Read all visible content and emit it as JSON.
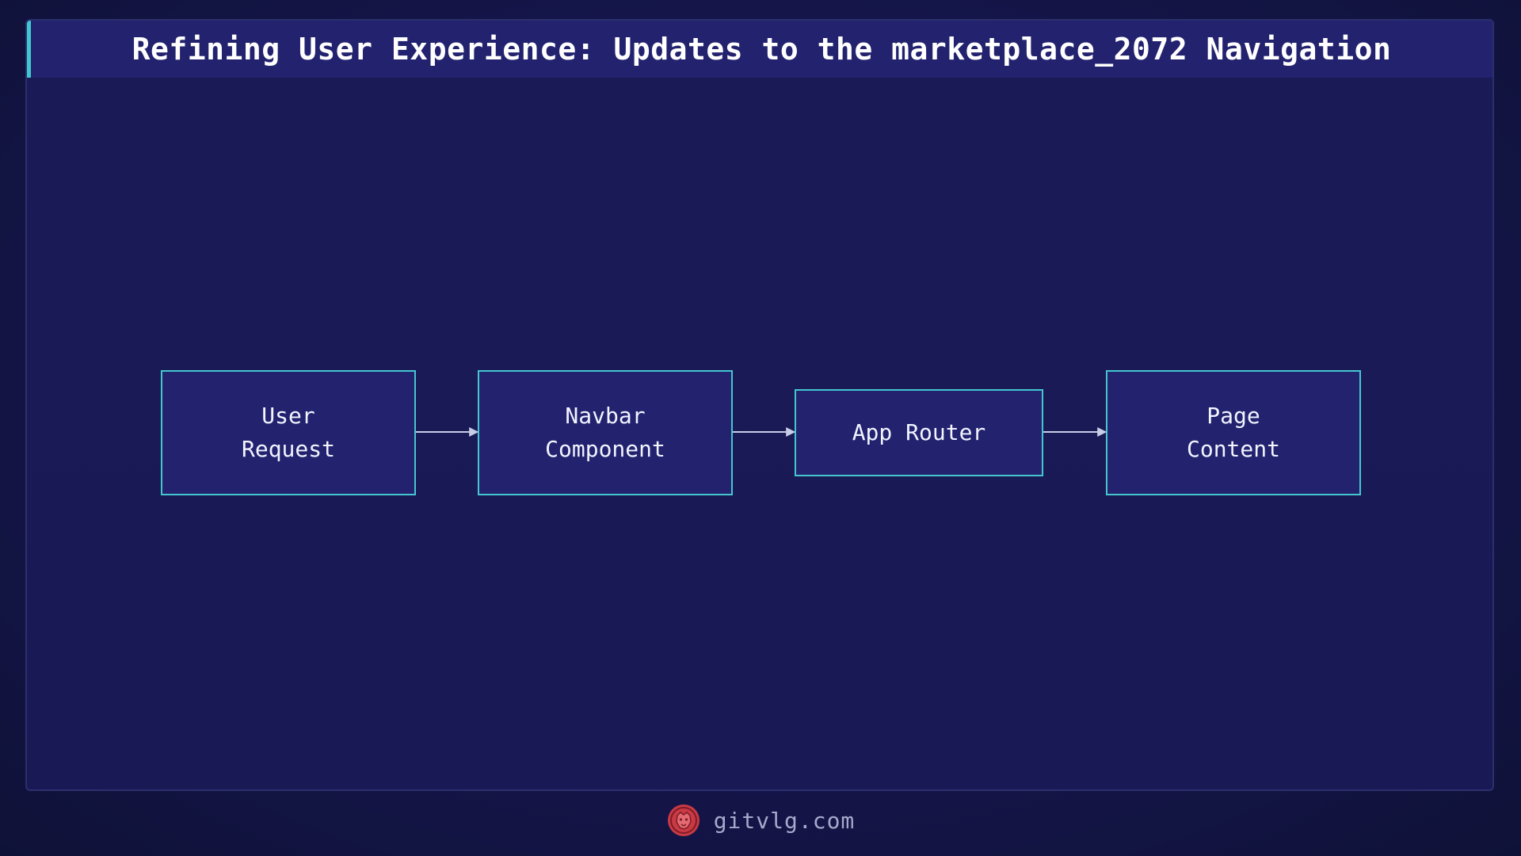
{
  "title": "Refining User Experience: Updates to the marketplace_2072 Navigation",
  "colors": {
    "background": "#17174c",
    "node_fill": "#22226f",
    "node_border": "#45c6cf",
    "accent": "#3fc9cf",
    "edge": "#c9cce6",
    "logo": "#c93a45"
  },
  "diagram": {
    "nodes": [
      {
        "id": "user-request",
        "label": "User\nRequest"
      },
      {
        "id": "navbar-component",
        "label": "Navbar\nComponent"
      },
      {
        "id": "app-router",
        "label": "App Router"
      },
      {
        "id": "page-content",
        "label": "Page\nContent"
      }
    ],
    "edges": [
      {
        "from": "user-request",
        "to": "navbar-component"
      },
      {
        "from": "navbar-component",
        "to": "app-router"
      },
      {
        "from": "app-router",
        "to": "page-content"
      }
    ]
  },
  "footer": {
    "site": "gitvlg.com",
    "logo_icon": "lion-head-icon"
  }
}
